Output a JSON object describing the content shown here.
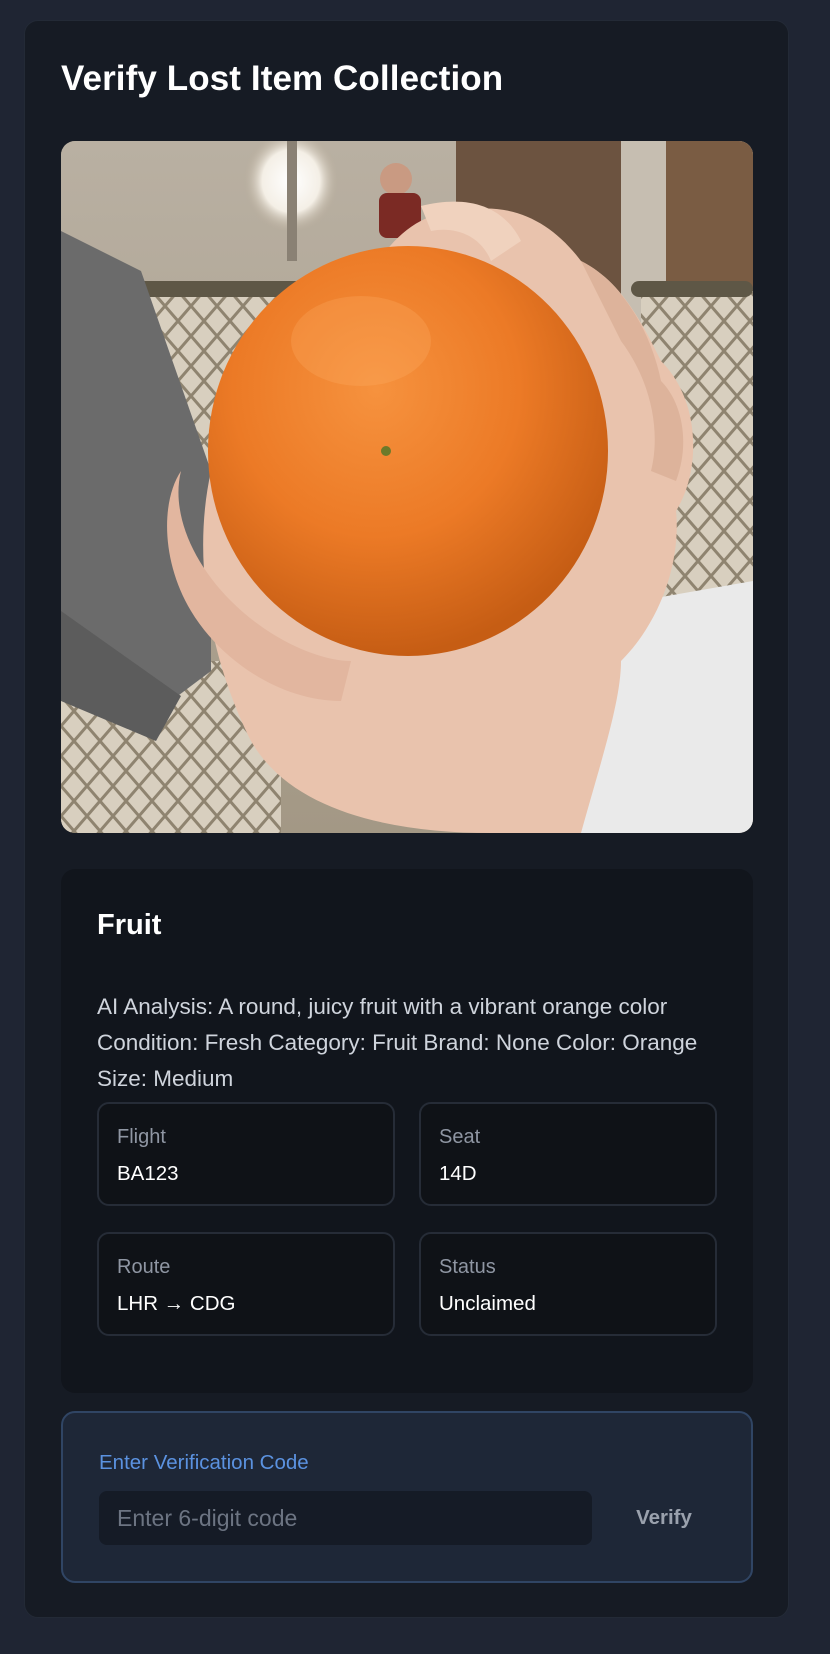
{
  "page": {
    "title": "Verify Lost Item Collection"
  },
  "item": {
    "photo_icon": "orange-in-hand-photo",
    "name": "Fruit",
    "description": "AI Analysis: A round, juicy fruit with a vibrant orange color Condition: Fresh Category: Fruit Brand: None Color: Orange Size: Medium",
    "fields": [
      {
        "label": "Flight",
        "value": "BA123"
      },
      {
        "label": "Seat",
        "value": "14D"
      },
      {
        "label": "Route",
        "value": "LHR → CDG"
      },
      {
        "label": "Status",
        "value": "Unclaimed"
      }
    ]
  },
  "verification": {
    "label": "Enter Verification Code",
    "placeholder": "Enter 6-digit code",
    "value": "",
    "button_label": "Verify"
  },
  "colors": {
    "background": "#1f2533",
    "card": "#161b24",
    "panel": "#11151c",
    "accent": "#5b92e0",
    "verify_border": "#304564"
  }
}
